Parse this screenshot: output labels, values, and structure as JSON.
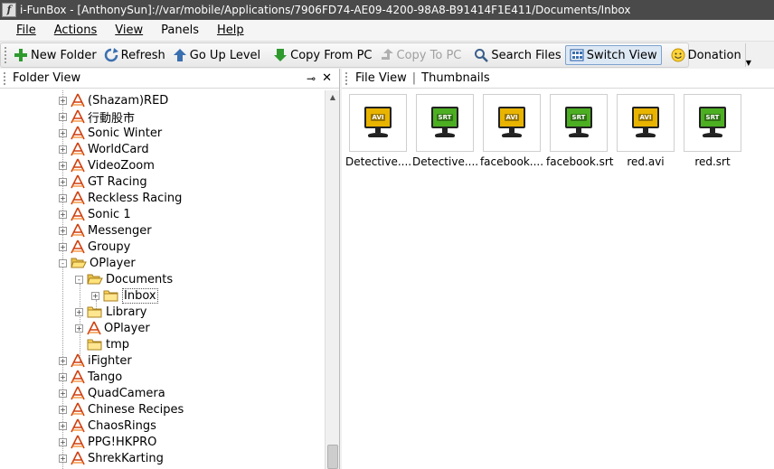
{
  "window": {
    "title": "i-FunBox - [AnthonySun]://var/mobile/Applications/7906FD74-AE09-4200-98A8-B91414F1E411/Documents/Inbox"
  },
  "menu": [
    "File",
    "Actions",
    "View",
    "Panels",
    "Help"
  ],
  "toolbar": {
    "new_folder": "New Folder",
    "refresh": "Refresh",
    "go_up": "Go Up Level",
    "copy_from_pc": "Copy From PC",
    "copy_to_pc": "Copy To PC",
    "search_files": "Search Files",
    "switch_view": "Switch View",
    "donation": "Donation"
  },
  "folder_view": {
    "title": "Folder View",
    "tree": [
      {
        "label": "(Shazam)RED",
        "icon": "app-icon",
        "level": 0,
        "expander": "+"
      },
      {
        "label": "行動股市",
        "icon": "app-icon",
        "level": 0,
        "expander": "+"
      },
      {
        "label": "Sonic Winter",
        "icon": "app-icon",
        "level": 0,
        "expander": "+"
      },
      {
        "label": "WorldCard",
        "icon": "app-icon",
        "level": 0,
        "expander": "+"
      },
      {
        "label": "VideoZoom",
        "icon": "app-icon",
        "level": 0,
        "expander": "+"
      },
      {
        "label": "GT Racing",
        "icon": "app-icon",
        "level": 0,
        "expander": "+"
      },
      {
        "label": "Reckless Racing",
        "icon": "app-icon",
        "level": 0,
        "expander": "+"
      },
      {
        "label": "Sonic 1",
        "icon": "app-icon",
        "level": 0,
        "expander": "+"
      },
      {
        "label": "Messenger",
        "icon": "app-icon",
        "level": 0,
        "expander": "+"
      },
      {
        "label": "Groupy",
        "icon": "app-icon",
        "level": 0,
        "expander": "+"
      },
      {
        "label": "OPlayer",
        "icon": "folder-open-icon",
        "level": 0,
        "expander": "-"
      },
      {
        "label": "Documents",
        "icon": "folder-open-icon",
        "level": 1,
        "expander": "-"
      },
      {
        "label": "Inbox",
        "icon": "folder-icon",
        "level": 2,
        "expander": "+",
        "selected": true
      },
      {
        "label": "Library",
        "icon": "folder-icon",
        "level": 1,
        "expander": "+"
      },
      {
        "label": "OPlayer",
        "icon": "app-icon",
        "level": 1,
        "expander": "+"
      },
      {
        "label": "tmp",
        "icon": "folder-icon",
        "level": 1,
        "expander": ""
      },
      {
        "label": "iFighter",
        "icon": "app-icon",
        "level": 0,
        "expander": "+"
      },
      {
        "label": "Tango",
        "icon": "app-icon",
        "level": 0,
        "expander": "+"
      },
      {
        "label": "QuadCamera",
        "icon": "app-icon",
        "level": 0,
        "expander": "+"
      },
      {
        "label": "Chinese Recipes",
        "icon": "app-icon",
        "level": 0,
        "expander": "+"
      },
      {
        "label": "ChaosRings",
        "icon": "app-icon",
        "level": 0,
        "expander": "+"
      },
      {
        "label": "PPG!HKPRO",
        "icon": "app-icon",
        "level": 0,
        "expander": "+"
      },
      {
        "label": "ShrekKarting",
        "icon": "app-icon",
        "level": 0,
        "expander": "+"
      }
    ]
  },
  "file_view": {
    "tab_file_view": "File View",
    "tab_thumbnails": "Thumbnails",
    "files": [
      {
        "name": "Detective....",
        "type": "AVI",
        "color": "#e8b400"
      },
      {
        "name": "Detective....",
        "type": "SRT",
        "color": "#4caf22"
      },
      {
        "name": "facebook....",
        "type": "AVI",
        "color": "#e8b400"
      },
      {
        "name": "facebook.srt",
        "type": "SRT",
        "color": "#4caf22"
      },
      {
        "name": "red.avi",
        "type": "AVI",
        "color": "#e8b400"
      },
      {
        "name": "red.srt",
        "type": "SRT",
        "color": "#4caf22"
      }
    ]
  }
}
